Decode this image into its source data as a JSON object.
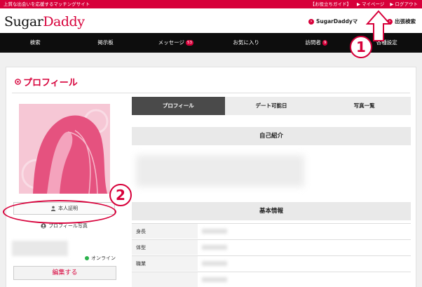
{
  "topbar": {
    "tagline": "上質な出会いを応援するマッチングサイト",
    "links": [
      "【お役立ちガイド】",
      "▶ マイページ",
      "▶ ログアウト"
    ]
  },
  "header": {
    "logo_main": "Sugar",
    "logo_accent": "Daddy",
    "link_sugardaddy": "SugarDaddyマ",
    "link_search": "出張検索"
  },
  "nav": {
    "items": [
      "検索",
      "掲示板",
      "メッセージ",
      "お気に入り",
      "訪問者",
      "各種設定"
    ],
    "message_badge": "53",
    "visitor_badge": "9"
  },
  "profile": {
    "title": "プロフィール",
    "verify_label": "本人証明",
    "photo_label": "プロフィール写真",
    "online_label": "オンライン",
    "edit_label": "編集する"
  },
  "tabs": [
    "プロフィール",
    "デート可能日",
    "写真一覧"
  ],
  "sections": {
    "intro": "自己紹介",
    "basic": "基本情報"
  },
  "basic_rows": [
    "身長",
    "体型",
    "職業",
    ""
  ],
  "callouts": [
    "1",
    "2"
  ],
  "colors": {
    "brand": "#d7003a",
    "nav": "#0d0d0d",
    "online": "#2bb24c"
  }
}
